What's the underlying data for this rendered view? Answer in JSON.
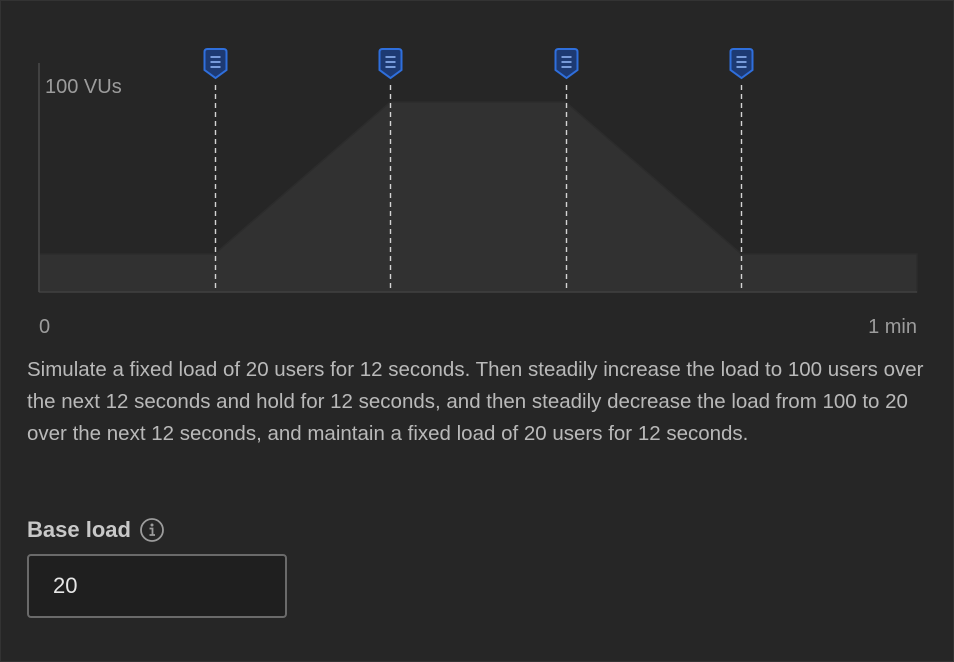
{
  "chart_data": {
    "type": "area",
    "x": [
      0,
      12,
      24,
      36,
      48,
      60
    ],
    "values": [
      20,
      20,
      100,
      100,
      20,
      20
    ],
    "xunit": "seconds",
    "markers_x": [
      12,
      24,
      36,
      48
    ],
    "ylim": [
      0,
      100
    ],
    "xlim": [
      0,
      60
    ],
    "y_max_label": "100 VUs",
    "x_start_label": "0",
    "x_end_label": "1 min",
    "colors": {
      "area_fill": "#313131",
      "area_stroke": "#2c2c2c",
      "axis": "#4a4a4a",
      "marker_line": "#d4d4d4",
      "marker_icon": "#2f6fdc",
      "label": "#9c9c9c"
    },
    "marker_icon": "list-icon"
  },
  "description": "Simulate a fixed load of 20 users for 12 seconds. Then steadily increase the load to 100 users over the next 12 seconds and hold for 12 seconds, and then steadily decrease the load from 100 to 20 over the next 12 seconds, and maintain a fixed load of 20 users for 12 seconds.",
  "base_load": {
    "label": "Base load",
    "icon": "info-icon",
    "value": "20"
  }
}
